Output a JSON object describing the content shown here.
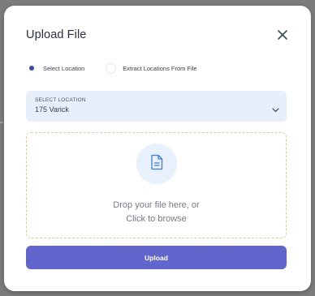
{
  "modal": {
    "title": "Upload File",
    "close_icon": "close-icon"
  },
  "location_mode": {
    "options": [
      {
        "label": "Select Location",
        "selected": true
      },
      {
        "label": "Extract Locations From File",
        "selected": false
      }
    ]
  },
  "location_select": {
    "label": "SELECT LOCATION",
    "value": "175 Varick",
    "icon": "chevron-down-icon"
  },
  "dropzone": {
    "icon": "file-icon",
    "line1": "Drop your file here, or",
    "line2": "Click to browse"
  },
  "upload_button": {
    "label": "Upload"
  },
  "colors": {
    "accent": "#6165cc",
    "radio_selected": "#3f4a9e",
    "select_bg": "#e9effa",
    "dropzone_border": "#e0c9a8",
    "file_icon": "#3b7fd6"
  }
}
